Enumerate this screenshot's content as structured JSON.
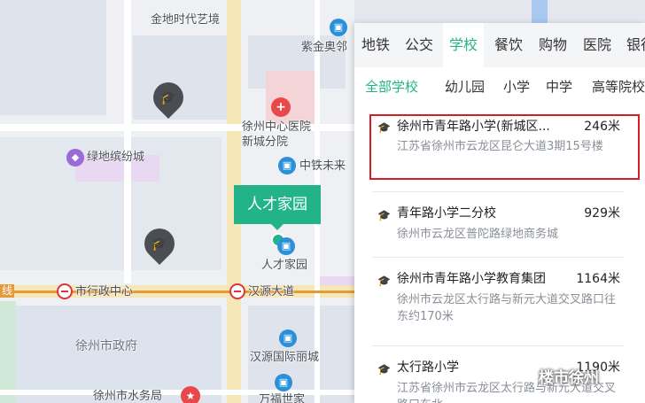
{
  "map": {
    "labels": {
      "gold_times": "金地时代艺境",
      "zijin": "紫金奥邻",
      "hospital": "徐州中心医院\n新城分院",
      "greenland": "绿地缤纷城",
      "zhongtie": "中铁未来",
      "rencai_poi": "人才家园",
      "shizhengfu_zhongxin": "市行政中心",
      "hanyuan_ave": "汉源大道",
      "xuzhou_gov": "徐州市政府",
      "hanyuan_intl": "汉源国际丽城",
      "wanfu": "万福世家",
      "tax_bureau": "徐州市水务局",
      "line_tag": "线"
    },
    "callout": "人才家园",
    "colors": {
      "green": "#23b38a",
      "poi_blue": "#2a90d9",
      "hospital_red": "#e8484a",
      "metro_red": "#d9363e"
    }
  },
  "panel": {
    "category_tabs": [
      {
        "label": "地铁",
        "active": false
      },
      {
        "label": "公交",
        "active": false
      },
      {
        "label": "学校",
        "active": true
      },
      {
        "label": "餐饮",
        "active": false
      },
      {
        "label": "购物",
        "active": false
      },
      {
        "label": "医院",
        "active": false
      },
      {
        "label": "银行",
        "active": false
      }
    ],
    "sub_tabs": [
      {
        "label": "全部学校",
        "active": true
      },
      {
        "label": "幼儿园",
        "active": false
      },
      {
        "label": "小学",
        "active": false
      },
      {
        "label": "中学",
        "active": false
      },
      {
        "label": "高等院校",
        "active": false
      }
    ],
    "schools": [
      {
        "name": "徐州市青年路小学(新城区...",
        "distance": "246米",
        "address": "江苏省徐州市云龙区昆仑大道3期15号楼",
        "highlighted": true
      },
      {
        "name": "青年路小学二分校",
        "distance": "929米",
        "address": "徐州市云龙区普陀路绿地商务城"
      },
      {
        "name": "徐州市青年路小学教育集团",
        "distance": "1164米",
        "address": "徐州市云龙区太行路与新元大道交叉路口往东约170米"
      },
      {
        "name": "太行路小学",
        "distance": "1190米",
        "address": "江苏省徐州市云龙区太行路与新元大道交叉路口东北"
      }
    ]
  },
  "watermark": "楼市徐州"
}
